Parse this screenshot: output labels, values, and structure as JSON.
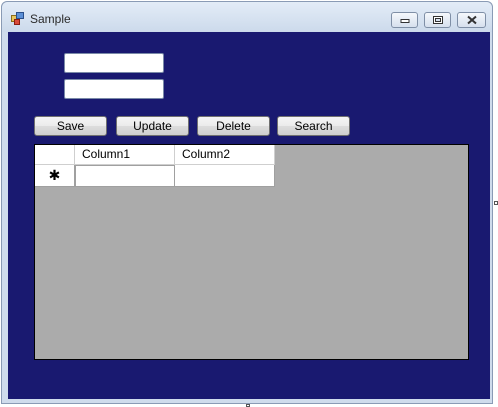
{
  "window": {
    "title": "Sample",
    "icon": "app-window-icon",
    "controls": [
      "minimize-icon",
      "maximize-icon",
      "close-icon"
    ],
    "client_background": "#191970"
  },
  "form": {
    "input1_value": "",
    "input2_value": ""
  },
  "buttons": {
    "save": "Save",
    "update": "Update",
    "delete": "Delete",
    "search": "Search"
  },
  "grid": {
    "columns": [
      "Column1",
      "Column2"
    ],
    "new_row_marker": "✱",
    "rows": [
      [
        "",
        ""
      ]
    ],
    "background": "#ababab"
  }
}
